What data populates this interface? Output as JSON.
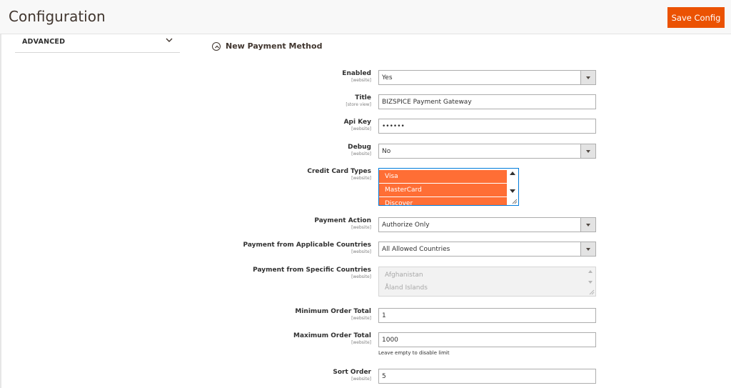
{
  "header": {
    "title": "Configuration",
    "save_label": "Save Config"
  },
  "sidebar": {
    "advanced_label": "ADVANCED"
  },
  "section": {
    "title": "New Payment Method"
  },
  "fields": {
    "enabled": {
      "label": "Enabled",
      "scope": "[website]",
      "value": "Yes"
    },
    "title": {
      "label": "Title",
      "scope": "[store view]",
      "value": "BIZSPICE Payment Gateway"
    },
    "api_key": {
      "label": "Api Key",
      "scope": "[website]",
      "value": "••••••"
    },
    "debug": {
      "label": "Debug",
      "scope": "[website]",
      "value": "No"
    },
    "cc_types": {
      "label": "Credit Card Types",
      "scope": "[website]",
      "options": [
        "Visa",
        "MasterCard",
        "Discover"
      ]
    },
    "payment_action": {
      "label": "Payment Action",
      "scope": "[website]",
      "value": "Authorize Only"
    },
    "applicable_countries": {
      "label": "Payment from Applicable Countries",
      "scope": "[website]",
      "value": "All Allowed Countries"
    },
    "specific_countries": {
      "label": "Payment from Specific Countries",
      "scope": "[website]",
      "options": [
        "Afghanistan",
        "Åland Islands"
      ]
    },
    "min_total": {
      "label": "Minimum Order Total",
      "scope": "[website]",
      "value": "1"
    },
    "max_total": {
      "label": "Maximum Order Total",
      "scope": "[website]",
      "value": "1000",
      "note": "Leave empty to disable limit"
    },
    "sort_order": {
      "label": "Sort Order",
      "scope": "[website]",
      "value": "5"
    }
  },
  "colors": {
    "accent": "#eb5202",
    "selected_option": "#ff6e35"
  }
}
